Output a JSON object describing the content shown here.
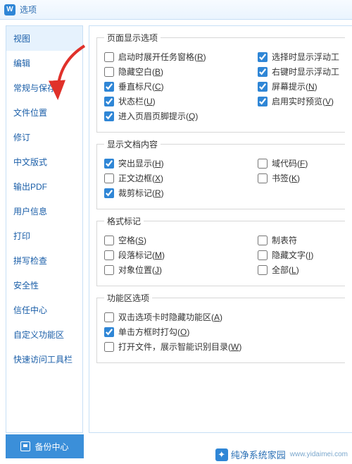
{
  "title": "选项",
  "app_icon_letter": "W",
  "sidebar": {
    "items": [
      {
        "label": "视图"
      },
      {
        "label": "编辑"
      },
      {
        "label": "常规与保存"
      },
      {
        "label": "文件位置"
      },
      {
        "label": "修订"
      },
      {
        "label": "中文版式"
      },
      {
        "label": "输出PDF"
      },
      {
        "label": "用户信息"
      },
      {
        "label": "打印"
      },
      {
        "label": "拼写检查"
      },
      {
        "label": "安全性"
      },
      {
        "label": "信任中心"
      },
      {
        "label": "自定义功能区"
      },
      {
        "label": "快速访问工具栏"
      }
    ],
    "selected_index": 0
  },
  "groups": {
    "page_display": {
      "title": "页面显示选项",
      "items": [
        {
          "label": "启动时展开任务窗格(",
          "accel": "R",
          "tail": ")",
          "checked": false
        },
        {
          "label": "选择时显示浮动工",
          "accel": "",
          "tail": "",
          "checked": true
        },
        {
          "label": "隐藏空白(",
          "accel": "B",
          "tail": ")",
          "checked": false
        },
        {
          "label": "右键时显示浮动工",
          "accel": "",
          "tail": "",
          "checked": true
        },
        {
          "label": "垂直标尺(",
          "accel": "C",
          "tail": ")",
          "checked": true
        },
        {
          "label": "屏幕提示(",
          "accel": "N",
          "tail": ")",
          "checked": true
        },
        {
          "label": "状态栏(",
          "accel": "U",
          "tail": ")",
          "checked": true
        },
        {
          "label": "启用实时预览(",
          "accel": "V",
          "tail": ")",
          "checked": true
        },
        {
          "label": "进入页眉页脚提示(",
          "accel": "Q",
          "tail": ")",
          "checked": true
        }
      ]
    },
    "doc_content": {
      "title": "显示文档内容",
      "items": [
        {
          "label": "突出显示(",
          "accel": "H",
          "tail": ")",
          "checked": true
        },
        {
          "label": "域代码(",
          "accel": "F",
          "tail": ")",
          "checked": false
        },
        {
          "label": "正文边框(",
          "accel": "X",
          "tail": ")",
          "checked": false
        },
        {
          "label": "书签(",
          "accel": "K",
          "tail": ")",
          "checked": false
        },
        {
          "label": "裁剪标记(",
          "accel": "R",
          "tail": ")",
          "checked": true
        }
      ]
    },
    "format_marks": {
      "title": "格式标记",
      "items": [
        {
          "label": "空格(",
          "accel": "S",
          "tail": ")",
          "checked": false
        },
        {
          "label": "制表符",
          "accel": "",
          "tail": "",
          "checked": false
        },
        {
          "label": "段落标记(",
          "accel": "M",
          "tail": ")",
          "checked": false
        },
        {
          "label": "隐藏文字(",
          "accel": "I",
          "tail": ")",
          "checked": false
        },
        {
          "label": "对象位置(",
          "accel": "J",
          "tail": ")",
          "checked": false
        },
        {
          "label": "全部(",
          "accel": "L",
          "tail": ")",
          "checked": false
        }
      ]
    },
    "ribbon": {
      "title": "功能区选项",
      "items": [
        {
          "label": "双击选项卡时隐藏功能区(",
          "accel": "A",
          "tail": ")",
          "checked": false
        },
        {
          "label": "单击方框时打勾(",
          "accel": "O",
          "tail": ")",
          "checked": true
        },
        {
          "label": "打开文件，展示智能识别目录(",
          "accel": "W",
          "tail": ")",
          "checked": false
        }
      ]
    }
  },
  "footer": {
    "label": "备份中心"
  },
  "watermark": {
    "brand": "纯净系统家园",
    "url": "www.yidaimei.com"
  }
}
